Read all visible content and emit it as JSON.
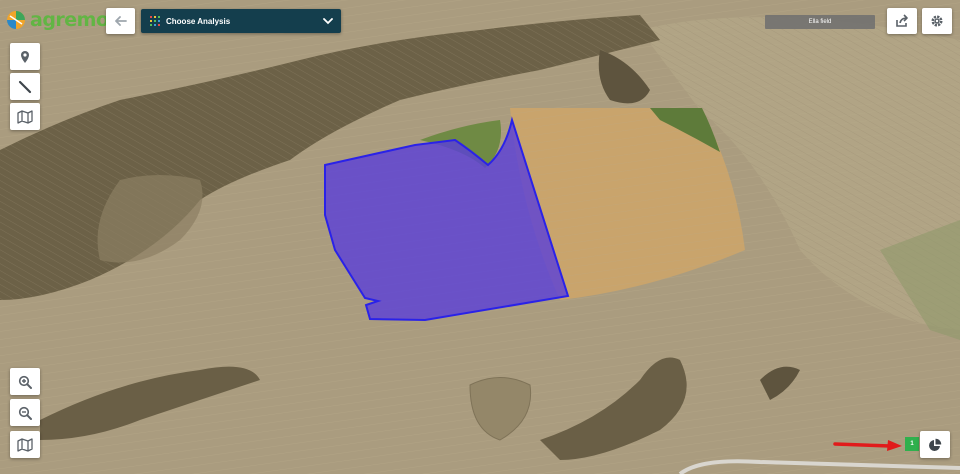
{
  "brand": {
    "logo_text": "agremo"
  },
  "header": {
    "analysis_dropdown_label": "Choose Analysis",
    "field_name": "Ella field"
  },
  "results": {
    "badge_count": "1"
  },
  "colors": {
    "header_bg": "#143e4d",
    "brand_green": "#62b544",
    "polygon_fill": "#5a3fd9",
    "polygon_stroke": "#2a22e8",
    "badge_green": "#2fb04d",
    "annotation_arrow": "#e11b1b"
  },
  "icons": {
    "back": "arrow-left-icon",
    "analysis": "grid-dots-icon",
    "dropdown": "chevron-down-icon",
    "share": "share-icon",
    "settings": "gear-icon",
    "pin": "map-pin-icon",
    "measure": "ruler-line-icon",
    "layers": "map-icon",
    "zoom_in": "zoom-in-icon",
    "zoom_out": "zoom-out-icon",
    "basemap": "map-icon",
    "report": "pie-chart-icon"
  }
}
